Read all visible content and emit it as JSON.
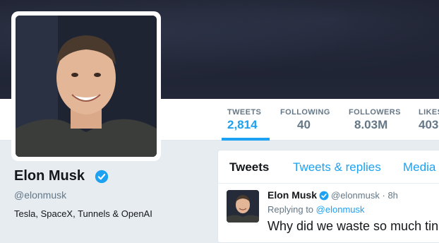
{
  "profile": {
    "name": "Elon Musk",
    "handle": "@elonmusk",
    "bio": "Tesla, SpaceX, Tunnels & OpenAI"
  },
  "stats": [
    {
      "label": "TWEETS",
      "value": "2,814",
      "active": true
    },
    {
      "label": "FOLLOWING",
      "value": "40",
      "active": false
    },
    {
      "label": "FOLLOWERS",
      "value": "8.03M",
      "active": false
    },
    {
      "label": "LIKES",
      "value": "403",
      "active": false
    }
  ],
  "tabs": [
    {
      "label": "Tweets",
      "active": true
    },
    {
      "label": "Tweets & replies",
      "active": false
    },
    {
      "label": "Media",
      "active": false
    }
  ],
  "tweet": {
    "author_name": "Elon Musk",
    "author_handle": "@elonmusk",
    "separator": "·",
    "time": "8h",
    "replying_prefix": "Replying to",
    "replying_handle": "@elonmusk",
    "text": "Why did we waste so much tin"
  },
  "colors": {
    "accent": "#1da1f2",
    "text_primary": "#14171a",
    "text_secondary": "#657786",
    "verified": "#1da1f2"
  },
  "icons": {
    "verified": "verified-badge-icon"
  }
}
